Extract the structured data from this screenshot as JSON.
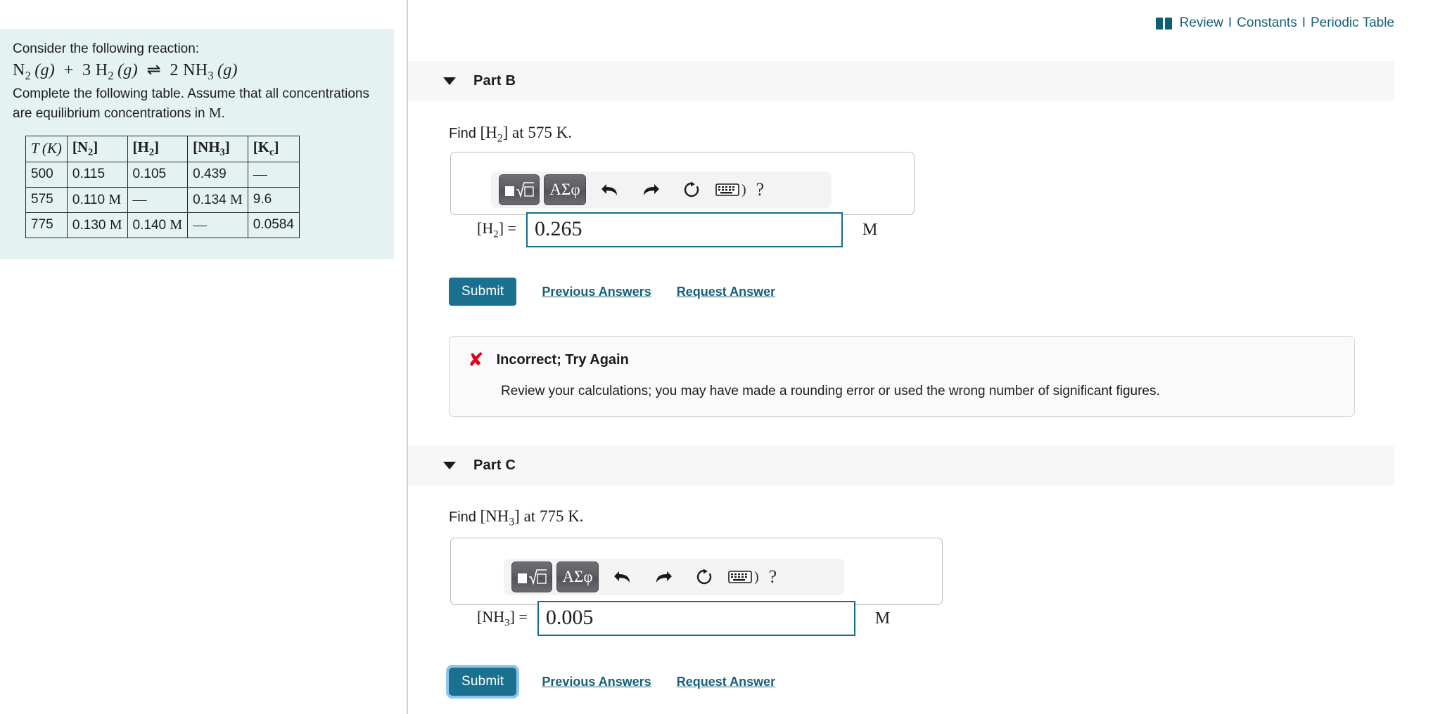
{
  "header": {
    "book_icon": "book-icon",
    "review_label": "Review",
    "separator": "I",
    "constants_label": "Constants",
    "periodic_table_label": "Periodic Table",
    "link_color": "#16617a"
  },
  "problem": {
    "intro": "Consider the following reaction:",
    "equation": {
      "reactant1": "N",
      "reactant1_sub": "2",
      "reactant1_state": "(g)",
      "plus": "+",
      "coeff2": "3",
      "reactant2": "H",
      "reactant2_sub": "2",
      "reactant2_state": "(g)",
      "arrow": "⇌",
      "coeff3": "2",
      "product": "NH",
      "product_sub": "3",
      "product_state": "(g)"
    },
    "instruction": "Complete the following table. Assume that all concentrations are equilibrium concentrations in M.",
    "panel_background": "#e4f2f1"
  },
  "table": {
    "headers": [
      "T (K)",
      "[N2]",
      "[H2]",
      "[NH3]",
      "[Kc]"
    ],
    "rows": [
      {
        "T": "500",
        "N2": "0.115",
        "H2": "0.105",
        "NH3": "0.439",
        "Kc": "—"
      },
      {
        "T": "575",
        "N2": "0.110 M",
        "H2": "—",
        "NH3": "0.134 M",
        "Kc": "9.6"
      },
      {
        "T": "775",
        "N2": "0.130 M",
        "H2": "0.140 M",
        "NH3": "—",
        "Kc": "0.0584"
      }
    ]
  },
  "parts": [
    {
      "id": "part-b",
      "title": "Part B",
      "caret": "caret-down-icon",
      "prompt_prefix": "Find ",
      "prompt_species": "[H",
      "prompt_species_sub": "2",
      "prompt_species_end": "]",
      "prompt_suffix": " at 575 K.",
      "toolbar": {
        "template_button": "sqrt-template-icon",
        "greek_button": "ΑΣφ",
        "undo": "undo-icon",
        "redo": "redo-icon",
        "reset": "reset-icon",
        "keyboard": "keyboard-icon",
        "keyboard_bracket": ")",
        "help": "?"
      },
      "input": {
        "label_main": "[H",
        "label_sub": "2",
        "label_end": "] =",
        "value": "0.265",
        "placeholder": "",
        "unit": "M"
      },
      "actions": {
        "submit": "Submit",
        "previous_answers": "Previous Answers",
        "request_answer": "Request Answer",
        "submit_focused": false
      },
      "feedback": {
        "icon": "x-mark-icon",
        "title": "Incorrect; Try Again",
        "body": "Review your calculations; you may have made a rounding error or used the wrong number of significant figures.",
        "icon_color": "#e3001b"
      }
    },
    {
      "id": "part-c",
      "title": "Part C",
      "caret": "caret-down-icon",
      "prompt_prefix": "Find ",
      "prompt_species": "[NH",
      "prompt_species_sub": "3",
      "prompt_species_end": "]",
      "prompt_suffix": " at 775 K.",
      "toolbar": {
        "template_button": "sqrt-template-icon",
        "greek_button": "ΑΣφ",
        "undo": "undo-icon",
        "redo": "redo-icon",
        "reset": "reset-icon",
        "keyboard": "keyboard-icon",
        "keyboard_bracket": ")",
        "help": "?"
      },
      "input": {
        "label_main": "[NH",
        "label_sub": "3",
        "label_end": "] =",
        "value": "0.005",
        "placeholder": "",
        "unit": "M"
      },
      "actions": {
        "submit": "Submit",
        "previous_answers": "Previous Answers",
        "request_answer": "Request Answer",
        "submit_focused": true
      }
    }
  ],
  "colors": {
    "accent": "#19708f",
    "link": "#16617a",
    "input_border": "#156b8a",
    "panel_bg": "#e4f2f1",
    "section_bg": "#f7f7f7",
    "focus_ring": "#8fc4ef"
  }
}
